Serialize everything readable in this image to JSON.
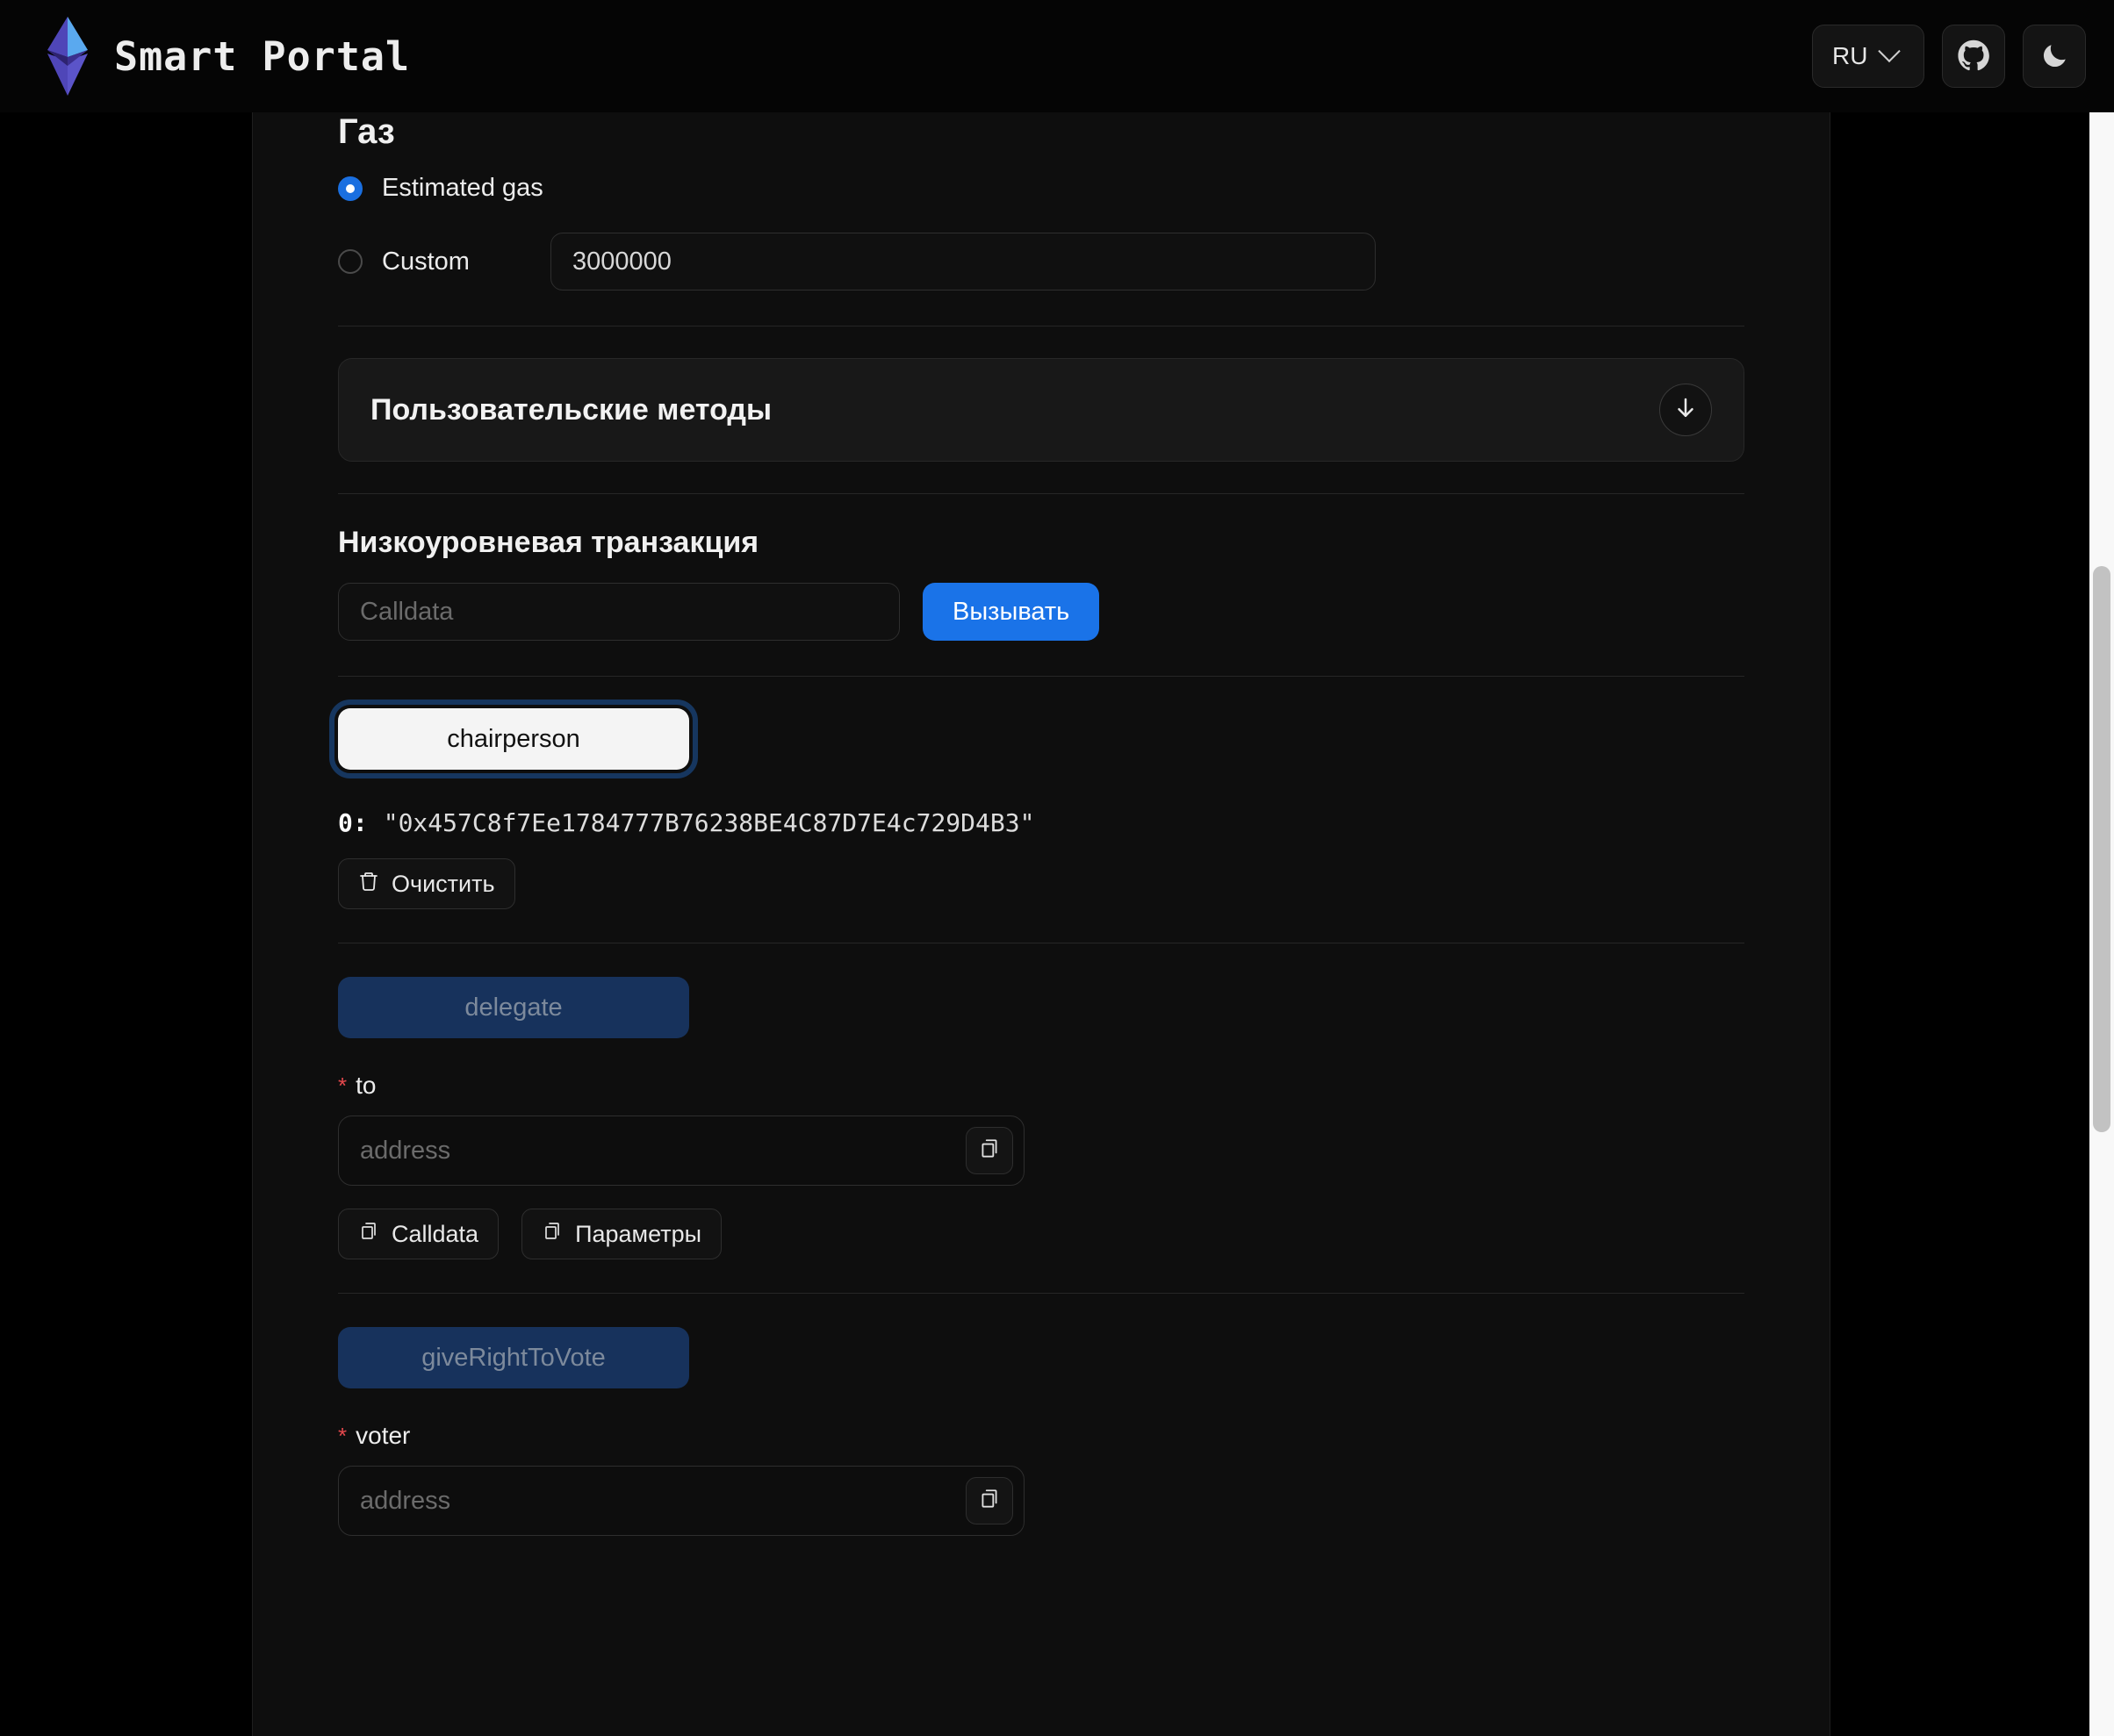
{
  "header": {
    "brand_title": "Smart Portal",
    "logo_icon": "ethereum-diamond-icon",
    "language": {
      "value": "RU",
      "chevron_icon": "chevron-down-icon"
    },
    "github": {
      "icon": "github-icon"
    },
    "theme_toggle": {
      "icon": "moon-icon"
    }
  },
  "gas": {
    "heading": "Газ",
    "estimated_label": "Estimated gas",
    "estimated_selected": true,
    "custom_label": "Custom",
    "custom_selected": false,
    "custom_value": "3000000"
  },
  "custom_methods": {
    "title": "Пользовательские методы",
    "expand_icon": "arrow-down-icon"
  },
  "low_level": {
    "heading": "Низкоуровневая транзакция",
    "calldata_placeholder": "Calldata",
    "calldata_value": "",
    "call_button": "Вызывать"
  },
  "methods": [
    {
      "name": "chairperson",
      "state": "active",
      "result": {
        "index": "0:",
        "value": "\"0x457C8f7Ee1784777B76238BE4C87D7E4c729D4B3\""
      },
      "clear_button": {
        "label": "Очистить",
        "icon": "trash-icon"
      }
    },
    {
      "name": "delegate",
      "state": "disabled",
      "params": [
        {
          "label": "to",
          "required_marker": "*",
          "placeholder": "address",
          "value": "",
          "copy_icon": "copy-icon"
        }
      ],
      "actions": [
        {
          "label": "Calldata",
          "icon": "copy-icon"
        },
        {
          "label": "Параметры",
          "icon": "copy-icon"
        }
      ]
    },
    {
      "name": "giveRightToVote",
      "state": "disabled",
      "params": [
        {
          "label": "voter",
          "required_marker": "*",
          "placeholder": "address",
          "value": "",
          "copy_icon": "copy-icon"
        }
      ]
    }
  ],
  "colors": {
    "accent_blue": "#1a73e8",
    "radio_blue": "#1a6fe0",
    "disabled_button_bg": "#17325c",
    "required_red": "#e5484d",
    "page_bg": "#000000",
    "card_bg": "#0e0e0e"
  },
  "scrollbar": {
    "orientation": "vertical"
  }
}
